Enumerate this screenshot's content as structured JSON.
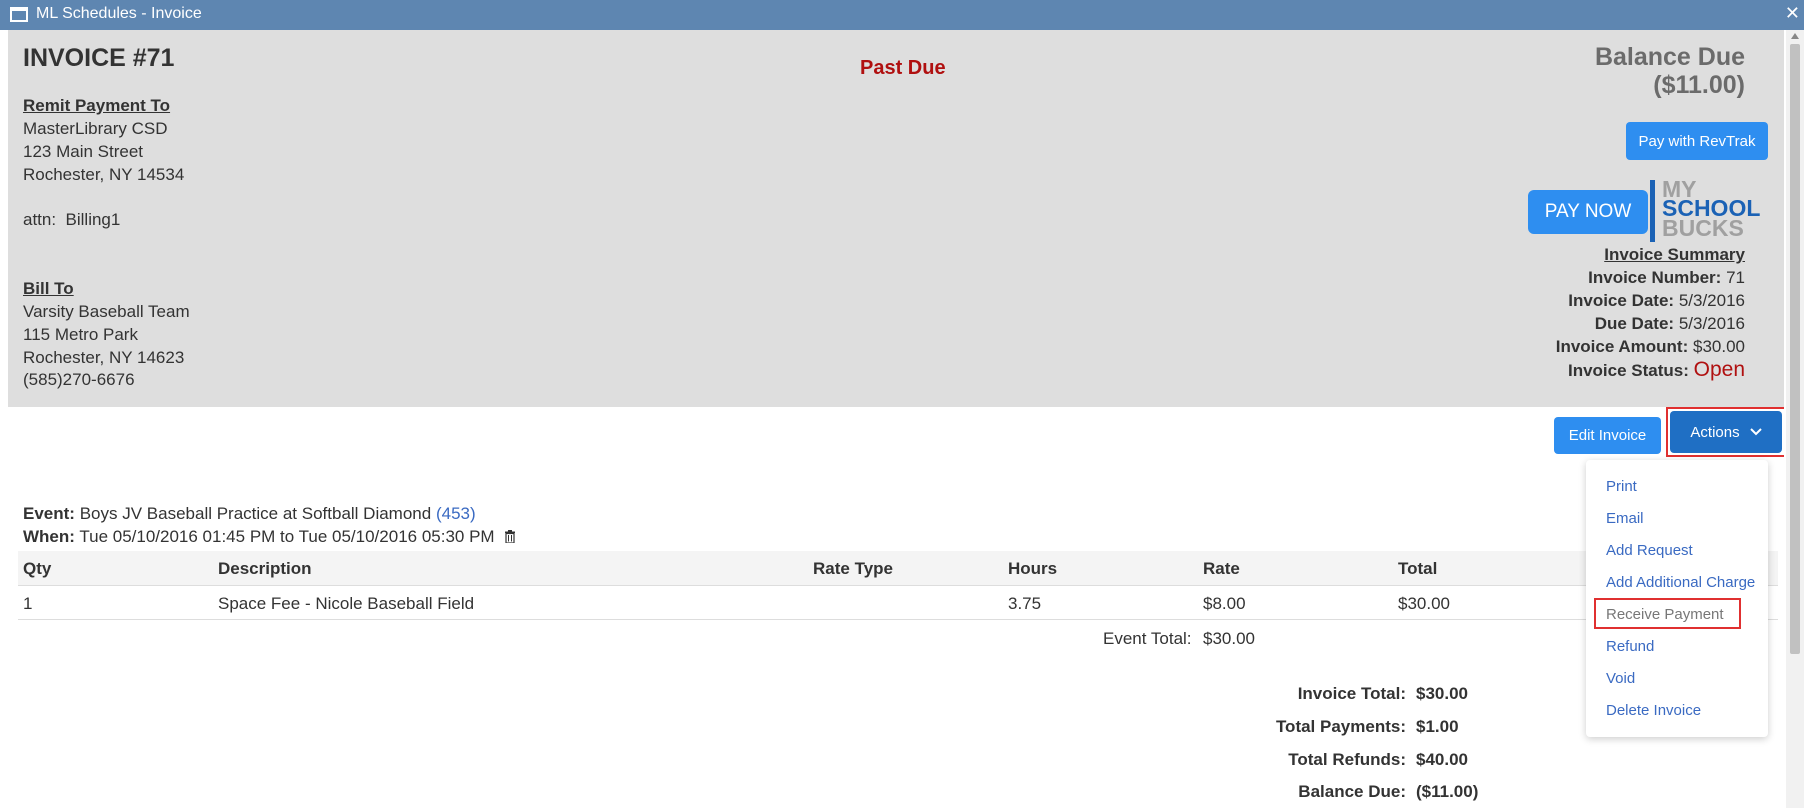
{
  "window": {
    "title": "ML Schedules - Invoice",
    "close": "✕"
  },
  "invoice": {
    "title": "INVOICE #71",
    "past_due": "Past Due",
    "balance_due_label": "Balance Due",
    "balance_due_value": "($11.00)",
    "pay_revtrak": "Pay with RevTrak",
    "pay_now": "PAY NOW",
    "logo": {
      "line1": "MY",
      "line2": "SCHOOL",
      "line3": "BUCKS"
    }
  },
  "remit": {
    "heading": "Remit Payment To",
    "name": "MasterLibrary CSD",
    "street": "123 Main Street",
    "city": "Rochester, NY 14534",
    "attn": "attn:  Billing1"
  },
  "bill_to": {
    "heading": "Bill To",
    "name": "Varsity Baseball Team",
    "street": "115 Metro Park",
    "city": "Rochester, NY 14623",
    "phone": "(585)270-6676"
  },
  "summary": {
    "heading": "Invoice Summary",
    "number_label": "Invoice Number:",
    "number": "71",
    "date_label": "Invoice Date:",
    "date": "5/3/2016",
    "due_label": "Due Date:",
    "due": "5/3/2016",
    "amount_label": "Invoice Amount:",
    "amount": "$30.00",
    "status_label": "Invoice Status:",
    "status": "Open"
  },
  "buttons": {
    "edit": "Edit Invoice",
    "actions": "Actions"
  },
  "actions_menu": [
    "Print",
    "Email",
    "Add Request",
    "Add Additional Charge",
    "Receive Payment",
    "Refund",
    "Void",
    "Delete Invoice"
  ],
  "event": {
    "label": "Event:",
    "name": "Boys JV Baseball Practice at Softball Diamond",
    "id": "(453)",
    "when_label": "When:",
    "when": "Tue 05/10/2016 01:45 PM to Tue 05/10/2016 05:30 PM"
  },
  "table": {
    "headers": [
      "Qty",
      "Description",
      "Rate Type",
      "Hours",
      "Rate",
      "Total"
    ],
    "rows": [
      [
        "1",
        "Space Fee - Nicole Baseball Field",
        "",
        "3.75",
        "$8.00",
        "$30.00"
      ]
    ],
    "event_total_label": "Event Total:",
    "event_total": "$30.00"
  },
  "totals": {
    "invoice_total_label": "Invoice Total:",
    "invoice_total": "$30.00",
    "payments_label": "Total Payments:",
    "payments": "$1.00",
    "refunds_label": "Total Refunds:",
    "refunds": "$40.00",
    "balance_label": "Balance Due:",
    "balance": "($11.00)"
  }
}
